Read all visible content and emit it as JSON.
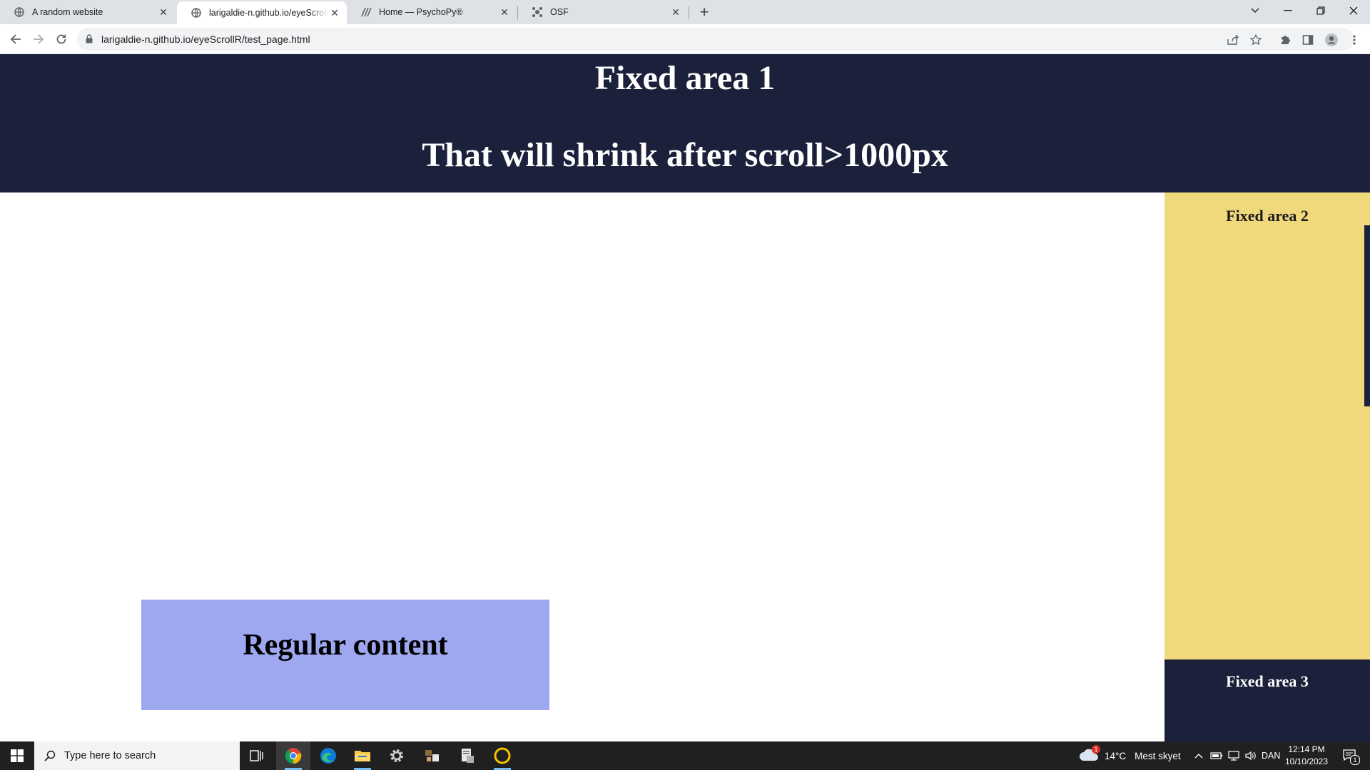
{
  "browser": {
    "tabs": [
      {
        "title": "A random website",
        "active": false,
        "icon": "globe-icon"
      },
      {
        "title": "larigaldie-n.github.io/eyeScrollR/test_page.html",
        "active": true,
        "icon": "globe-icon"
      },
      {
        "title": "Home — PsychoPy®",
        "active": false,
        "icon": "psychopy-icon"
      },
      {
        "title": "OSF",
        "active": false,
        "icon": "osf-icon"
      }
    ],
    "url": "larigaldie-n.github.io/eyeScrollR/test_page.html"
  },
  "page": {
    "fixed_area_1_title": "Fixed area 1",
    "fixed_area_1_subtitle": "That will shrink after scroll>1000px",
    "fixed_area_2": "Fixed area 2",
    "fixed_area_3": "Fixed area 3",
    "regular_content": "Regular content",
    "colors": {
      "dark_navy": "#1c213b",
      "yellow": "#f0d87c",
      "periwinkle": "#9ea8f0"
    }
  },
  "taskbar": {
    "search_placeholder": "Type here to search",
    "weather": {
      "temp": "14°C",
      "desc": "Mest skyet",
      "badge": "1"
    },
    "language": "DAN",
    "time": "12:14 PM",
    "date": "10/10/2023",
    "notification_count": "1"
  }
}
